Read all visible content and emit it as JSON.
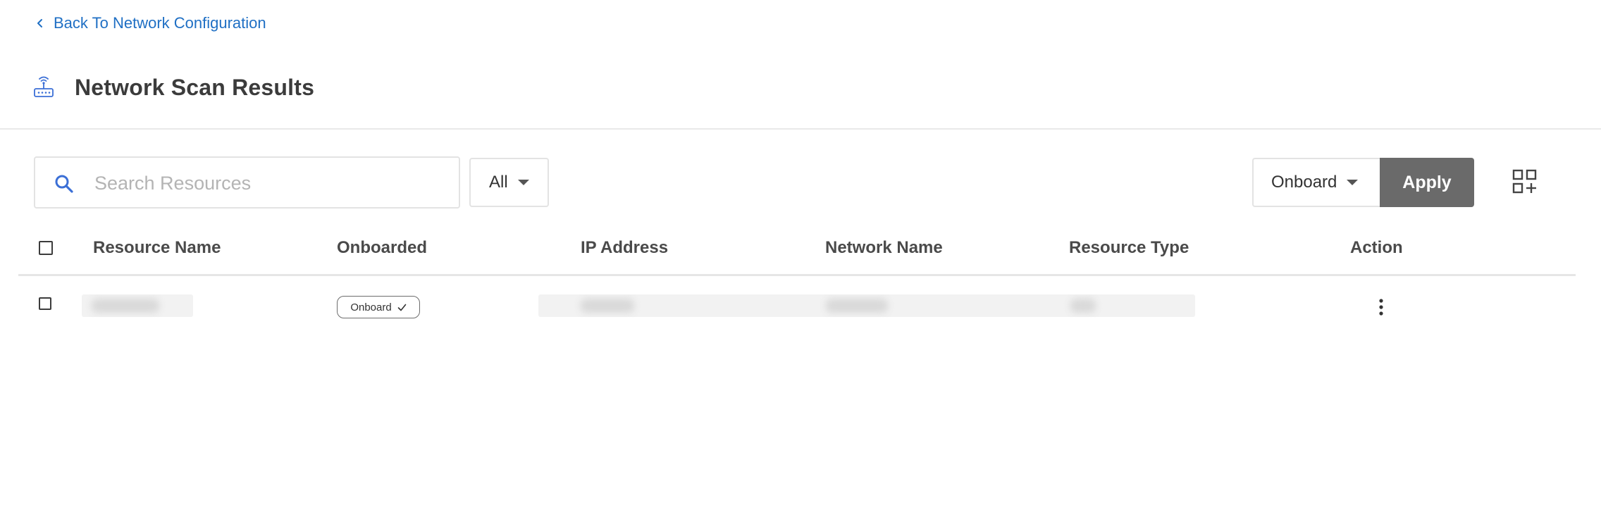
{
  "breadcrumb": {
    "back_label": "Back To Network Configuration"
  },
  "header": {
    "title": "Network Scan Results"
  },
  "toolbar": {
    "search_placeholder": "Search Resources",
    "filter_value": "All",
    "bulk_action_value": "Onboard",
    "apply_label": "Apply"
  },
  "table": {
    "columns": [
      "Resource Name",
      "Onboarded",
      "IP Address",
      "Network Name",
      "Resource Type",
      "Action"
    ],
    "rows": [
      {
        "onboarded_label": "Onboard"
      }
    ]
  },
  "colors": {
    "link": "#1f6fc4",
    "accent_icon": "#3b6fd6",
    "apply_bg": "#6a6a6a"
  },
  "icons": {
    "back": "chevron-left-icon",
    "title": "router-icon",
    "search": "search-icon",
    "dropdown": "caret-down-icon",
    "columns": "grid-add-icon",
    "badge": "check-icon",
    "row_action": "kebab-menu-icon"
  }
}
